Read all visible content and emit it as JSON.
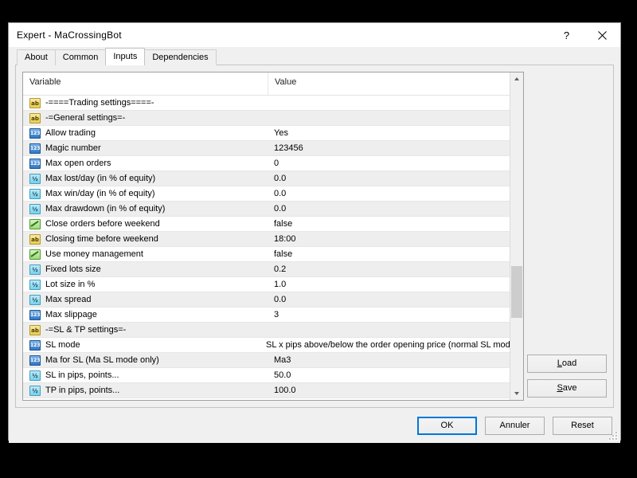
{
  "window": {
    "title": "Expert - MaCrossingBot",
    "help_icon": "question-mark-icon",
    "close_icon": "close-icon"
  },
  "tabs": [
    {
      "label": "About",
      "selected": false
    },
    {
      "label": "Common",
      "selected": false
    },
    {
      "label": "Inputs",
      "selected": true
    },
    {
      "label": "Dependencies",
      "selected": false
    }
  ],
  "grid": {
    "columns": [
      "Variable",
      "Value"
    ],
    "rows": [
      {
        "icon": "string",
        "variable": "-====Trading settings====-",
        "value": ""
      },
      {
        "icon": "string",
        "variable": "-=General settings=-",
        "value": ""
      },
      {
        "icon": "int",
        "variable": "Allow trading",
        "value": "Yes"
      },
      {
        "icon": "int",
        "variable": "Magic number",
        "value": "123456"
      },
      {
        "icon": "int",
        "variable": "Max open orders",
        "value": "0"
      },
      {
        "icon": "dbl",
        "variable": "Max lost/day (in % of equity)",
        "value": "0.0"
      },
      {
        "icon": "dbl",
        "variable": "Max win/day (in % of equity)",
        "value": "0.0"
      },
      {
        "icon": "dbl",
        "variable": "Max drawdown (in % of equity)",
        "value": "0.0"
      },
      {
        "icon": "bool",
        "variable": "Close orders before weekend",
        "value": "false"
      },
      {
        "icon": "string",
        "variable": "Closing time before weekend",
        "value": "18:00"
      },
      {
        "icon": "bool",
        "variable": "Use money management",
        "value": "false"
      },
      {
        "icon": "dbl",
        "variable": "Fixed lots size",
        "value": "0.2"
      },
      {
        "icon": "dbl",
        "variable": "Lot size in %",
        "value": "1.0"
      },
      {
        "icon": "dbl",
        "variable": "Max spread",
        "value": "0.0"
      },
      {
        "icon": "int",
        "variable": "Max slippage",
        "value": "3"
      },
      {
        "icon": "string",
        "variable": "-=SL & TP settings=-",
        "value": ""
      },
      {
        "icon": "int",
        "variable": "SL mode",
        "value": "SL x pips above/below the order opening price (normal SL mode)"
      },
      {
        "icon": "int",
        "variable": "Ma for SL (Ma SL mode only)",
        "value": "Ma3"
      },
      {
        "icon": "dbl",
        "variable": "SL in pips, points...",
        "value": "50.0"
      },
      {
        "icon": "dbl",
        "variable": "TP in pips, points...",
        "value": "100.0"
      }
    ],
    "scrollbar": {
      "up_icon": "chevron-up-icon",
      "down_icon": "chevron-down-icon",
      "thumb_top_pct": 60,
      "thumb_height_pct": 17
    }
  },
  "side_buttons": [
    {
      "label": "Load",
      "accel": "L"
    },
    {
      "label": "Save",
      "accel": "S"
    }
  ],
  "footer_buttons": [
    {
      "label": "OK",
      "default": true
    },
    {
      "label": "Annuler",
      "default": false
    },
    {
      "label": "Reset",
      "default": false
    }
  ]
}
